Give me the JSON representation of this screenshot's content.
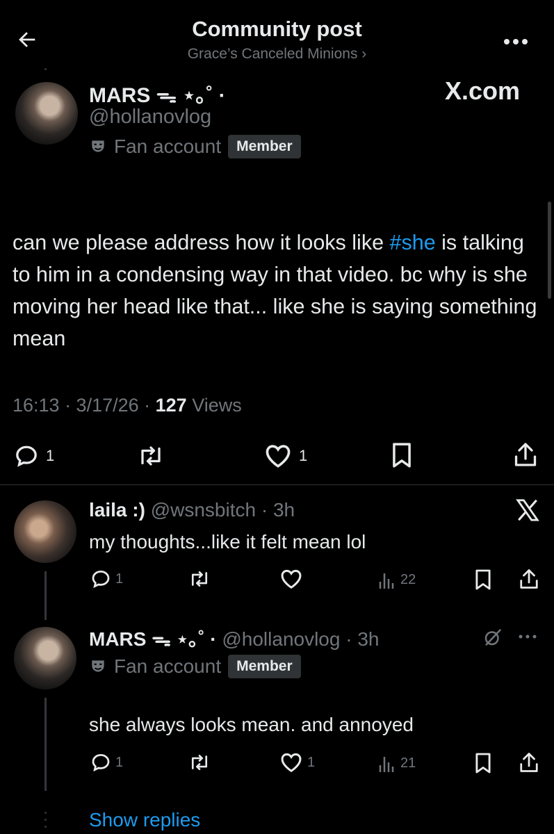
{
  "header": {
    "title": "Community post",
    "community": "Grace’s Canceled Minions ›"
  },
  "watermark": "X.com",
  "post": {
    "author_name": "MARS ᯓ ⋆｡˚ ·",
    "handle": "@hollanovlog",
    "fan_label": "Fan account",
    "member_badge": "Member",
    "text_before": "can we please address how it looks like ",
    "hashtag": "#she",
    "text_after": " is talking to him in a condensing way in that video. bc why is she moving her head like that... like she is saying something mean",
    "meta_time": "16:13 · 3/17/26 · ",
    "views_count": "127",
    "views_label": " Views",
    "replies": "1",
    "likes": "1"
  },
  "reply1": {
    "author_name": "laila :)",
    "handle_time": "@wsnsbitch · 3h",
    "text": "my thoughts...like it felt mean lol",
    "replies": "1",
    "views": "22"
  },
  "reply2": {
    "author_name": "MARS ᯓ ⋆｡˚ ·",
    "handle_time": "@hollanovlog · 3h",
    "fan_label": "Fan account",
    "member_badge": "Member",
    "text": "she always looks mean. and annoyed",
    "replies": "1",
    "likes": "1",
    "views": "21"
  },
  "show_replies": "Show replies",
  "colors": {
    "background": "#000000",
    "text": "#e7e9ea",
    "muted": "#71767b",
    "link": "#1d9bf0",
    "badge": "#2f3336"
  }
}
